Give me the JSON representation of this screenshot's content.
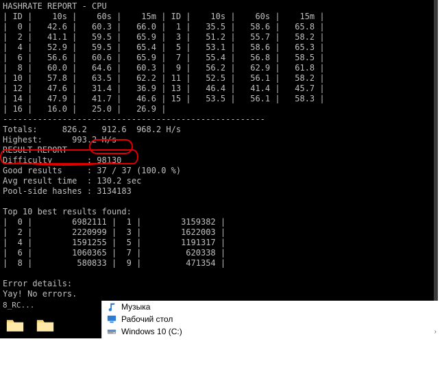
{
  "terminal": {
    "title": "HASHRATE REPORT - CPU",
    "col_labels": {
      "id": "ID",
      "t10s": "10s",
      "t60s": "60s",
      "t15m": "15m"
    },
    "rows": [
      {
        "id": 0,
        "t10s": "42.6",
        "t60s": "60.3",
        "t15m": "66.0",
        "id2": 1,
        "t10s2": "35.5",
        "t60s2": "58.6",
        "t15m2": "65.8"
      },
      {
        "id": 2,
        "t10s": "41.1",
        "t60s": "59.5",
        "t15m": "65.9",
        "id2": 3,
        "t10s2": "51.2",
        "t60s2": "55.7",
        "t15m2": "58.2"
      },
      {
        "id": 4,
        "t10s": "52.9",
        "t60s": "59.5",
        "t15m": "65.4",
        "id2": 5,
        "t10s2": "53.1",
        "t60s2": "58.6",
        "t15m2": "65.3"
      },
      {
        "id": 6,
        "t10s": "56.6",
        "t60s": "60.6",
        "t15m": "65.9",
        "id2": 7,
        "t10s2": "55.4",
        "t60s2": "56.8",
        "t15m2": "58.5"
      },
      {
        "id": 8,
        "t10s": "60.0",
        "t60s": "64.6",
        "t15m": "60.3",
        "id2": 9,
        "t10s2": "56.2",
        "t60s2": "62.9",
        "t15m2": "61.8"
      },
      {
        "id": 10,
        "t10s": "57.8",
        "t60s": "63.5",
        "t15m": "62.2",
        "id2": 11,
        "t10s2": "52.5",
        "t60s2": "56.1",
        "t15m2": "58.2"
      },
      {
        "id": 12,
        "t10s": "47.6",
        "t60s": "31.4",
        "t15m": "36.9",
        "id2": 13,
        "t10s2": "46.4",
        "t60s2": "41.4",
        "t15m2": "45.7"
      },
      {
        "id": 14,
        "t10s": "47.9",
        "t60s": "41.7",
        "t15m": "46.6",
        "id2": 15,
        "t10s2": "53.5",
        "t60s2": "56.1",
        "t15m2": "58.3"
      },
      {
        "id": 16,
        "t10s": "16.0",
        "t60s": "25.0",
        "t15m": "26.9"
      }
    ],
    "separator": "-----------------------------------------------------",
    "totals_label": "Totals:",
    "totals": [
      "826.2",
      "912.6",
      "968.2 H/s"
    ],
    "highest_label": "Highest:",
    "highest": "993.2 H/s",
    "result_title": "RESULT REPORT",
    "difficulty_label": "Difficulty",
    "difficulty": "98130",
    "good_label": "Good results",
    "good": "37 / 37 (100.0 %)",
    "avg_label": "Avg result time",
    "avg": "130.2 sec",
    "pool_label": "Pool-side hashes",
    "pool": "3134183",
    "top10_label": "Top 10 best results found:",
    "top10": [
      {
        "i": 0,
        "v": "6982111",
        "i2": 1,
        "v2": "3159382"
      },
      {
        "i": 2,
        "v": "2220999",
        "i2": 3,
        "v2": "1622003"
      },
      {
        "i": 4,
        "v": "1591255",
        "i2": 5,
        "v2": "1191317"
      },
      {
        "i": 6,
        "v": "1060365",
        "i2": 7,
        "v2": "620338"
      },
      {
        "i": 8,
        "v": "580833",
        "i2": 9,
        "v2": "471354"
      }
    ],
    "error_label": "Error details:",
    "error_msg": "Yay! No errors."
  },
  "desktop": {
    "file_label": "8_RC...",
    "explorer_items": [
      {
        "icon": "music-icon",
        "label": "Музыка"
      },
      {
        "icon": "desktop-icon",
        "label": "Рабочий стол"
      },
      {
        "icon": "drive-icon",
        "label": "Windows 10 (C:)"
      }
    ]
  }
}
